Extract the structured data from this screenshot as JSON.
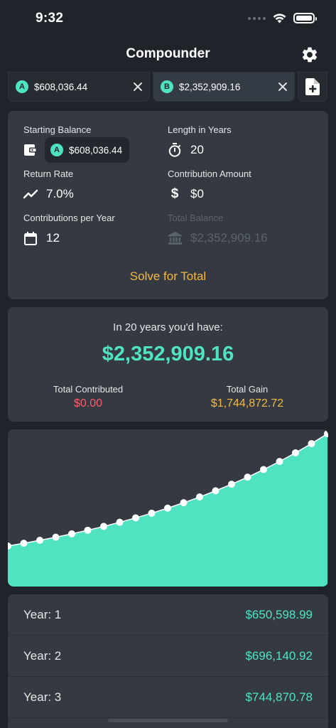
{
  "status": {
    "time": "9:32"
  },
  "nav": {
    "title": "Compounder"
  },
  "tabs": [
    {
      "badge": "A",
      "label": "$608,036.44"
    },
    {
      "badge": "B",
      "label": "$2,352,909.16"
    }
  ],
  "inputs": {
    "starting_balance": {
      "label": "Starting Balance",
      "badge": "A",
      "value": "$608,036.44"
    },
    "length_years": {
      "label": "Length in Years",
      "value": "20"
    },
    "return_rate": {
      "label": "Return Rate",
      "value": "7.0%"
    },
    "contribution_amount": {
      "label": "Contribution Amount",
      "value": "$0"
    },
    "contributions_per_year": {
      "label": "Contributions per Year",
      "value": "12"
    },
    "total_balance": {
      "label": "Total Balance",
      "value": "$2,352,909.16"
    },
    "solve_button": "Solve for Total"
  },
  "result": {
    "caption": "In 20 years you'd have:",
    "total": "$2,352,909.16",
    "contributed_label": "Total Contributed",
    "contributed_value": "$0.00",
    "gain_label": "Total Gain",
    "gain_value": "$1,744,872.72"
  },
  "chart_data": {
    "type": "area",
    "x": [
      0,
      1,
      2,
      3,
      4,
      5,
      6,
      7,
      8,
      9,
      10,
      11,
      12,
      13,
      14,
      15,
      16,
      17,
      18,
      19,
      20
    ],
    "values": [
      608036.44,
      650598.99,
      696140.92,
      744870.78,
      797011.73,
      852802.55,
      912498.73,
      976373.64,
      1044719.8,
      1117850.19,
      1196099.7,
      1279826.68,
      1369414.55,
      1465273.57,
      1567842.72,
      1677591.71,
      1795023.13,
      1920674.75,
      2055121.98,
      2198980.52,
      2352909.16
    ],
    "color": "#50e3c2"
  },
  "years": [
    {
      "label": "Year: 1",
      "value": "$650,598.99"
    },
    {
      "label": "Year: 2",
      "value": "$696,140.92"
    },
    {
      "label": "Year: 3",
      "value": "$744,870.78"
    }
  ]
}
